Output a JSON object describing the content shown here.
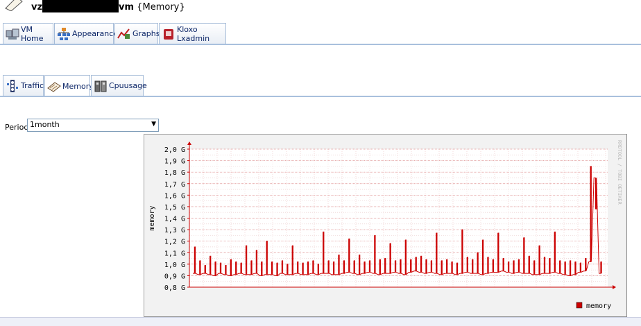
{
  "header": {
    "title_prefix": "vz",
    "title_suffix": "vm",
    "subtitle": "{Memory}"
  },
  "main_tabs": [
    {
      "label": "VM Home",
      "icon": "vm-home-icon"
    },
    {
      "label": "Appearance",
      "icon": "appearance-icon"
    },
    {
      "label": "Graphs",
      "icon": "graphs-icon"
    },
    {
      "label": "Kloxo Lxadmin",
      "icon": "kloxo-icon"
    }
  ],
  "graph_tabs": [
    {
      "label": "Traffic",
      "icon": "traffic-icon"
    },
    {
      "label": "Memory",
      "icon": "memory-icon",
      "active": true
    },
    {
      "label": "Cpuusage",
      "icon": "cpuusage-icon"
    }
  ],
  "period": {
    "label": "Period",
    "selected": "1month"
  },
  "chart_data": {
    "type": "line",
    "ylabel": "memory",
    "watermark": "RRDTOOL / TOBI OETIKER",
    "ylim": [
      0.8,
      2.0
    ],
    "yticks": [
      "0,8 G",
      "0,9 G",
      "1,0 G",
      "1,1 G",
      "1,2 G",
      "1,3 G",
      "1,4 G",
      "1,5 G",
      "1,6 G",
      "1,7 G",
      "1,8 G",
      "1,9 G",
      "2,0 G"
    ],
    "grid": true,
    "legend": {
      "position": "bottom-right",
      "entries": [
        {
          "name": "memory",
          "color": "#cc0000"
        }
      ]
    },
    "series": [
      {
        "name": "memory",
        "color": "#cc0000",
        "baseline": [
          0.92,
          0.91,
          0.92,
          0.91,
          0.9,
          0.92,
          0.91,
          0.9,
          0.91,
          0.92,
          0.91,
          0.91,
          0.92,
          0.9,
          0.91,
          0.91,
          0.9,
          0.92,
          0.91,
          0.91,
          0.92,
          0.91,
          0.91,
          0.92,
          0.91,
          0.92,
          0.92,
          0.91,
          0.91,
          0.92,
          0.93,
          0.92,
          0.91,
          0.92,
          0.93,
          0.92,
          0.91,
          0.92,
          0.92,
          0.93,
          0.92,
          0.91,
          0.93,
          0.94,
          0.93,
          0.92,
          0.93,
          0.92,
          0.91,
          0.92,
          0.92,
          0.91,
          0.92,
          0.93,
          0.92,
          0.92,
          0.91,
          0.92,
          0.93,
          0.93,
          0.94,
          0.93,
          0.92,
          0.93,
          0.92,
          0.92,
          0.91,
          0.91,
          0.92,
          0.92,
          0.93,
          0.92,
          0.91,
          0.9,
          0.91,
          0.93,
          0.94,
          1.02,
          1.75,
          0.92
        ],
        "spikes": [
          1.15,
          1.03,
          0.99,
          1.07,
          1.02,
          1.01,
          0.99,
          1.04,
          1.02,
          1.01,
          1.16,
          1.03,
          1.12,
          1.02,
          1.2,
          1.02,
          1.01,
          1.03,
          1.0,
          1.16,
          1.02,
          1.01,
          1.02,
          1.03,
          1.0,
          1.28,
          1.03,
          1.02,
          1.08,
          1.03,
          1.22,
          1.03,
          1.08,
          1.02,
          1.03,
          1.25,
          1.04,
          1.05,
          1.18,
          1.03,
          1.04,
          1.21,
          1.04,
          1.06,
          1.07,
          1.04,
          1.03,
          1.27,
          1.03,
          1.04,
          1.02,
          1.01,
          1.3,
          1.06,
          1.04,
          1.1,
          1.21,
          1.06,
          1.04,
          1.27,
          1.05,
          1.02,
          1.03,
          1.04,
          1.23,
          1.07,
          1.03,
          1.16,
          1.06,
          1.05,
          1.28,
          1.03,
          1.02,
          1.03,
          1.02,
          1.01,
          1.05,
          1.85,
          1.48,
          1.02
        ]
      }
    ]
  }
}
